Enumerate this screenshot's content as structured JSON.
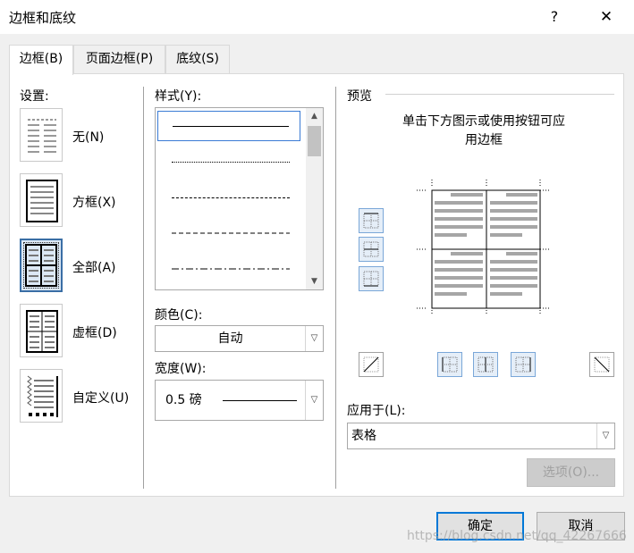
{
  "window": {
    "title": "边框和底纹",
    "help_label": "?",
    "close_label": "✕"
  },
  "tabs": [
    {
      "label": "边框(B)",
      "active": true
    },
    {
      "label": "页面边框(P)",
      "active": false
    },
    {
      "label": "底纹(S)",
      "active": false
    }
  ],
  "settings": {
    "heading": "设置:",
    "options": [
      {
        "label": "无(N)",
        "icon": "setting-none-icon",
        "selected": false
      },
      {
        "label": "方框(X)",
        "icon": "setting-box-icon",
        "selected": false
      },
      {
        "label": "全部(A)",
        "icon": "setting-all-icon",
        "selected": true
      },
      {
        "label": "虚框(D)",
        "icon": "setting-grid-icon",
        "selected": false
      },
      {
        "label": "自定义(U)",
        "icon": "setting-custom-icon",
        "selected": false
      }
    ]
  },
  "style": {
    "heading": "样式(Y):",
    "line_styles": [
      "solid",
      "dotted",
      "dashed-small",
      "dashed",
      "dash-dot"
    ],
    "selected_index": 0
  },
  "color": {
    "label": "颜色(C):",
    "value": "自动"
  },
  "width": {
    "label": "宽度(W):",
    "value": "0.5 磅"
  },
  "preview": {
    "heading": "预览",
    "instruction_line1": "单击下方图示或使用按钮可应",
    "instruction_line2": "用边框"
  },
  "apply_to": {
    "label": "应用于(L):",
    "value": "表格"
  },
  "buttons": {
    "options": "选项(O)...",
    "ok": "确定",
    "cancel": "取消"
  },
  "watermark": "https://blog.csdn.net/qq_42267666",
  "colors": {
    "accent": "#0078d7",
    "selection": "#3a6ea5"
  }
}
